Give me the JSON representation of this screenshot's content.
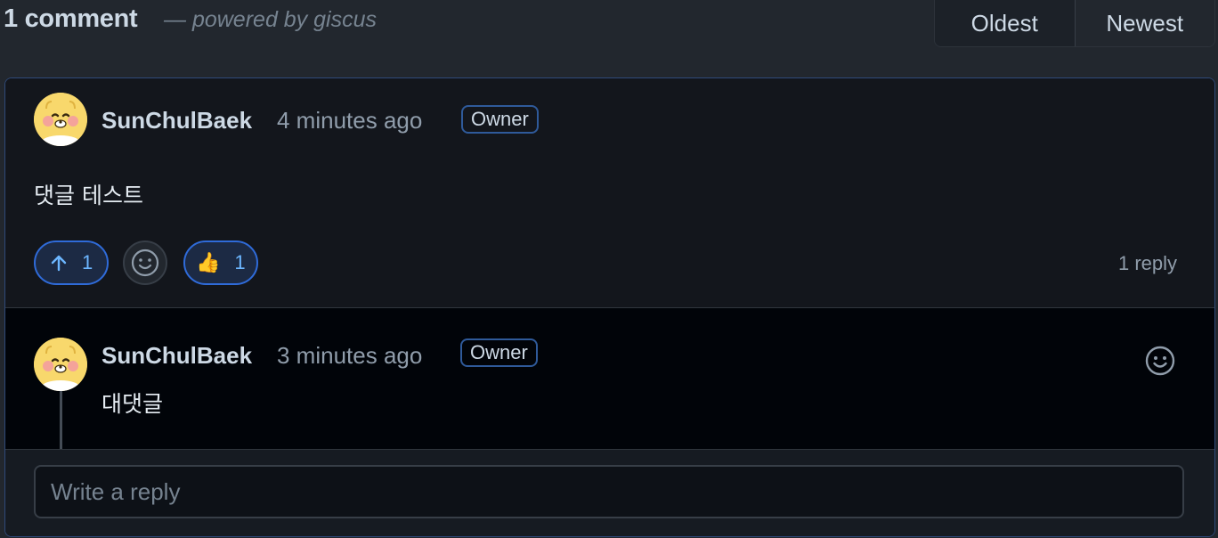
{
  "header": {
    "comment_count": "1 comment",
    "powered_by": "— powered by giscus",
    "sort_oldest": "Oldest",
    "sort_newest": "Newest"
  },
  "comment": {
    "author": "SunChulBaek",
    "time": "4 minutes ago",
    "badge": "Owner",
    "body": "댓글 테스트",
    "upvote_count": "1",
    "thumbs_emoji": "👍",
    "thumbs_count": "1",
    "replies_label": "1 reply"
  },
  "reply": {
    "author": "SunChulBaek",
    "time": "3 minutes ago",
    "badge": "Owner",
    "body": "대댓글"
  },
  "reply_input": {
    "placeholder": "Write a reply"
  },
  "colors": {
    "background": "#22272e",
    "card_border": "#2f4a7a",
    "accent_blue": "#6cb6ff",
    "avatar_yellow": "#f6d566"
  }
}
